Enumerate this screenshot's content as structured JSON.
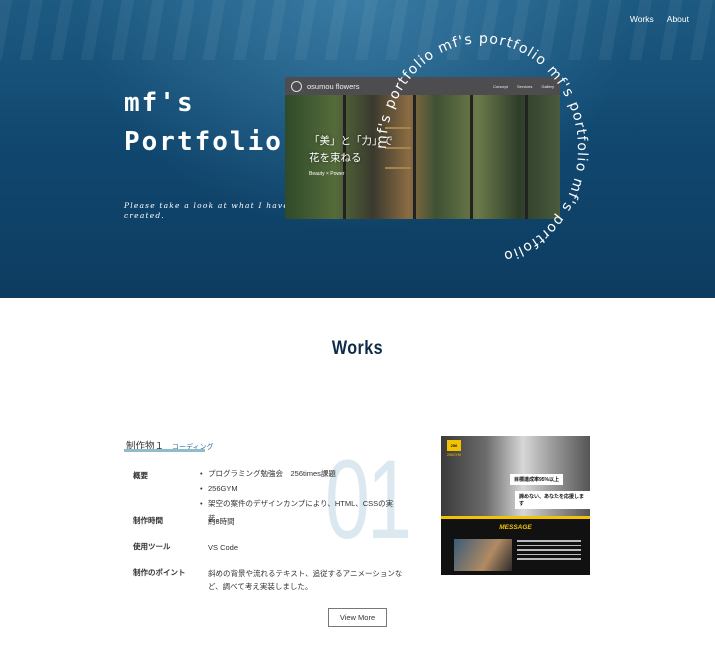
{
  "nav": {
    "items": [
      "Works",
      "About"
    ]
  },
  "hero": {
    "title_line1": "mf's",
    "title_line2": "Portfolio",
    "subtitle_line1": "Please take a look at what I have",
    "subtitle_line2": "created.",
    "ring_text": "mf's portfolio mf's portfolio mf's portfolio mf's portfolio "
  },
  "preview": {
    "site_title": "osumou flowers",
    "nav": [
      "Concept",
      "Services",
      "Gallery"
    ],
    "headline_line1": "「美」と「力」で",
    "headline_line2": "花を束ねる",
    "tagline": "Beauty × Power"
  },
  "works": {
    "title": "Works",
    "item": {
      "heading": "制作物１",
      "category": "コーディング",
      "number": "01",
      "rows": [
        {
          "label": "概要",
          "bullets": [
            "プログラミング勉強会　256times課題",
            "256GYM",
            "架空の案件のデザインカンプにより、HTML、CSSの実装。"
          ]
        },
        {
          "label": "制作時間",
          "value": "約8時間"
        },
        {
          "label": "使用ツール",
          "value": "VS Code"
        },
        {
          "label": "制作のポイント",
          "value": "斜めの背景や流れるテキスト、追従するアニメーションなど、調べて考え実装しました。"
        }
      ],
      "thumbnail": {
        "logo": "256",
        "logo_sub": "256GYM",
        "box1": "目標達成率95%以上",
        "box2": "諦めない、あなたを応援します",
        "message": "MESSAGE"
      }
    },
    "view_more": "View More"
  }
}
